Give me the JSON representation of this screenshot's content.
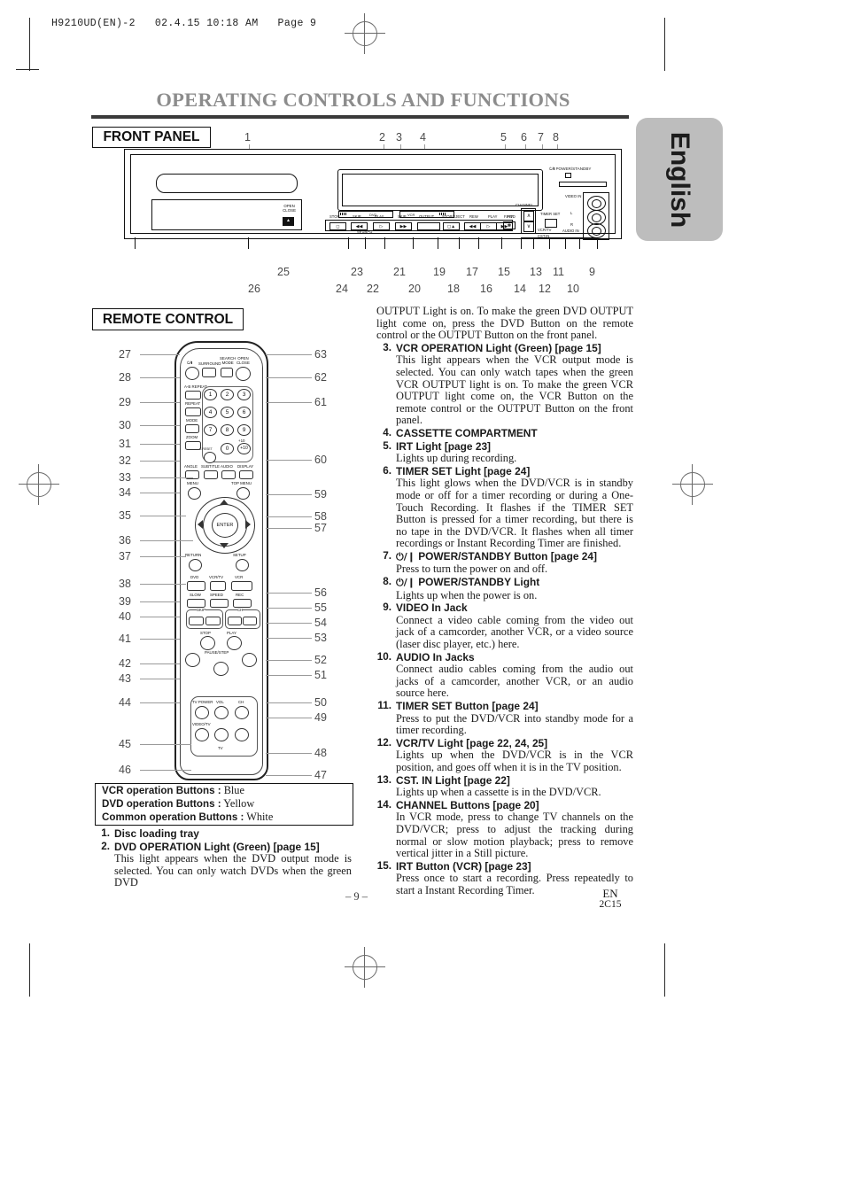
{
  "slug": "H9210UD(EN)-2   02.4.15 10:18 AM   Page 9",
  "lang_tab": "English",
  "chapter_title": "OPERATING CONTROLS AND FUNCTIONS",
  "sections": {
    "front_panel": "FRONT PANEL",
    "remote_control": "REMOTE CONTROL"
  },
  "front_panel_diagram": {
    "top_callouts": [
      "1",
      "2",
      "3",
      "4",
      "5",
      "6",
      "7",
      "8"
    ],
    "bottom_callouts_upper": [
      "25",
      "23",
      "21",
      "19",
      "17",
      "15",
      "13",
      "11",
      "9"
    ],
    "bottom_callouts_lower": [
      "26",
      "24",
      "22",
      "20",
      "18",
      "16",
      "14",
      "12",
      "10"
    ],
    "labels": {
      "open_close_1": "OPEN",
      "open_close_2": "CLOSE",
      "open_close_icon": "eject-icon",
      "dvd_tag": "DVD",
      "vcr_tag": "VCR",
      "stop": "STOP",
      "skip_left": "SKIP",
      "play_dvd": "PLAY",
      "skip_right": "SKIP",
      "output": "OUTPUT",
      "stop_eject": "STOP/EJECT",
      "rew": "REW",
      "play_vcr": "PLAY",
      "ffwd": "F.FWD",
      "search": "SEARCH",
      "irt_sym": "IRT",
      "channel": "CHANNEL",
      "timer_set": "TIMER SET",
      "vcr_tv": "VCR/TV",
      "cst_in": "CST.IN",
      "video_in": "VIDEO IN",
      "audio_in": "AUDIO IN",
      "audio_l": "L",
      "audio_r": "R",
      "power_standby": "POWER/STANDBY"
    }
  },
  "remote_diagram": {
    "left_callouts": [
      "27",
      "28",
      "29",
      "30",
      "31",
      "32",
      "33",
      "34",
      "35",
      "36",
      "37",
      "38",
      "39",
      "40",
      "41",
      "42",
      "43",
      "44",
      "45",
      "46"
    ],
    "right_callouts": [
      "63",
      "62",
      "61",
      "60",
      "59",
      "58",
      "57",
      "56",
      "55",
      "54",
      "53",
      "52",
      "51",
      "50",
      "49",
      "48",
      "47"
    ],
    "labels": {
      "surround": "SURROUND",
      "search_mode_1": "SEARCH",
      "search_mode_2": "MODE",
      "open_1": "OPEN",
      "close_2": "CLOSE",
      "ab_repeat": "A-B REPEAT",
      "repeat": "REPEAT",
      "mode": "MODE",
      "zoom": "ZOOM",
      "c_reset": "C.RESET",
      "angle": "ANGLE",
      "subtitle": "SUBTITLE",
      "audio": "AUDIO",
      "display": "DISPLAY",
      "menu": "MENU",
      "top_menu": "TOP MENU",
      "enter": "ENTER",
      "return": "RETURN",
      "setup": "SETUP",
      "dvd": "DVD",
      "vcr_tv": "VCR/TV",
      "vcr": "VCR",
      "slow": "SLOW",
      "speed": "SPEED",
      "rec": "REC",
      "skip": "SKIP",
      "ch": "CH",
      "stop": "STOP",
      "play": "PLAY",
      "pause_step": "PAUSE/STEP",
      "tv_power": "TV POWER",
      "vol": "VOL",
      "ch_tv": "CH",
      "video_tv": "VIDEO/TV",
      "tv": "TV",
      "plus10": "+10",
      "numbers": [
        "1",
        "2",
        "3",
        "4",
        "5",
        "6",
        "7",
        "8",
        "9",
        "0",
        "+10"
      ]
    }
  },
  "legend": [
    {
      "label": "VCR operation Buttons :",
      "value": "Blue"
    },
    {
      "label": "DVD operation Buttons :",
      "value": "Yellow"
    },
    {
      "label": "Common operation Buttons :",
      "value": "White"
    }
  ],
  "left_column": {
    "items": [
      {
        "num": "1.",
        "heading": "Disc loading tray",
        "body": ""
      },
      {
        "num": "2.",
        "heading": "DVD  OPERATION Light (Green) [page 15]",
        "body": "This light appears when the DVD output mode is selected. You can only watch DVDs when the green DVD"
      }
    ]
  },
  "right_column": {
    "continuation": "OUTPUT Light is on. To make the green DVD OUTPUT light come on, press the DVD Button on the remote control or the OUTPUT Button on the front panel.",
    "items": [
      {
        "num": "3.",
        "heading": "VCR OPERATION Light (Green) [page 15]",
        "body": "This light appears when the VCR output mode is selected. You can only watch tapes when the green VCR OUTPUT light is on. To make the green VCR OUTPUT light come on, the VCR Button on the remote control or the OUTPUT Button on the front panel."
      },
      {
        "num": "4.",
        "heading": "CASSETTE COMPARTMENT",
        "body": ""
      },
      {
        "num": "5.",
        "heading": "IRT Light [page 23]",
        "body": "Lights up during recording."
      },
      {
        "num": "6.",
        "heading": "TIMER SET Light [page 24]",
        "body": "This light glows when the DVD/VCR is in standby mode or off for a timer recording or during a One-Touch Recording. It flashes if the TIMER SET Button is pressed for a timer recording, but there is no tape in the DVD/VCR. It flashes when all timer recordings or Instant Recording Timer are finished."
      },
      {
        "num": "7.",
        "heading": "POWER/STANDBY Button [page 24]",
        "heading_prefix_symbol": "power-standby-icon",
        "body": "Press to turn the power on and off."
      },
      {
        "num": "8.",
        "heading": "POWER/STANDBY Light",
        "heading_prefix_symbol": "power-standby-icon",
        "body": "Lights up when the power is on."
      },
      {
        "num": "9.",
        "heading": "VIDEO In Jack",
        "body": "Connect a video cable coming from the video out jack of a camcorder, another VCR, or a video source (laser disc player, etc.) here."
      },
      {
        "num": "10.",
        "heading": "AUDIO In Jacks",
        "body": "Connect audio cables coming from the audio out jacks of a camcorder, another VCR, or an audio source here."
      },
      {
        "num": "11.",
        "heading": "TIMER SET Button [page 24]",
        "body": "Press to put the DVD/VCR into standby mode for a timer recording."
      },
      {
        "num": "12.",
        "heading": "VCR/TV Light [page 22, 24, 25]",
        "body": "Lights up when the DVD/VCR is in the VCR position, and goes off when it is in the TV position."
      },
      {
        "num": "13.",
        "heading": "CST. IN Light [page 22]",
        "body": "Lights up when a cassette is in the DVD/VCR."
      },
      {
        "num": "14.",
        "heading": "CHANNEL Buttons [page 20]",
        "body": "In VCR mode, press to change TV channels on the DVD/VCR; press to adjust the tracking during normal or slow motion playback; press to remove vertical jitter in a Still picture."
      },
      {
        "num": "15.",
        "heading": "IRT Button (VCR) [page 23]",
        "body": "Press once to start a recording. Press repeatedly to start a Instant Recording Timer."
      }
    ]
  },
  "footer": {
    "page_number": "– 9 –",
    "region": "EN",
    "code": "2C15"
  }
}
